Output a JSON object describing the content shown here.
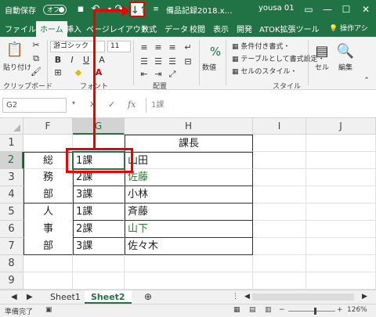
{
  "titlebar": {
    "autosave_label": "自動保存",
    "autosave_state": "オフ",
    "filename": "備品記録2018.x…",
    "user": "yousa 01",
    "sort_icon_glyph": "↓↑"
  },
  "ribbon_tabs": [
    "ファイル",
    "ホーム",
    "挿入",
    "ページレイアウト",
    "数式",
    "データ",
    "校閲",
    "表示",
    "開発",
    "ATOK拡張ツール",
    "操作アシ"
  ],
  "ribbon": {
    "paste_label": "貼り付け",
    "clipboard_label": "クリップボード",
    "font_name": "游ゴシック",
    "font_size": "11",
    "font_group_label": "フォント",
    "align_group_label": "配置",
    "number_label": "数値",
    "styles": [
      "条件付き書式・",
      "テーブルとして書式設定・",
      "セルのスタイル・"
    ],
    "styles_group_label": "スタイル",
    "cell_label": "セル",
    "edit_label": "編集",
    "percent": "%"
  },
  "formula_bar": {
    "namebox": "G2",
    "content": "1課"
  },
  "columns": [
    "F",
    "G",
    "H",
    "I",
    "J"
  ],
  "rows": [
    "1",
    "2",
    "3",
    "4",
    "5",
    "6",
    "7",
    "8",
    "9"
  ],
  "cells": {
    "h1": "課長",
    "f": [
      "総",
      "務",
      "部",
      "人",
      "事",
      "部"
    ],
    "g": [
      "1課",
      "2課",
      "3課",
      "1課",
      "2課",
      "3課"
    ],
    "h": [
      "山田",
      "佐藤",
      "小林",
      "斉藤",
      "山下",
      "佐々木"
    ]
  },
  "sheets": [
    "Sheet1",
    "Sheet2"
  ],
  "status": {
    "ready": "準備完了",
    "zoom": "126%"
  },
  "colors": {
    "excel_green": "#217346",
    "highlight_red": "#e00000"
  }
}
